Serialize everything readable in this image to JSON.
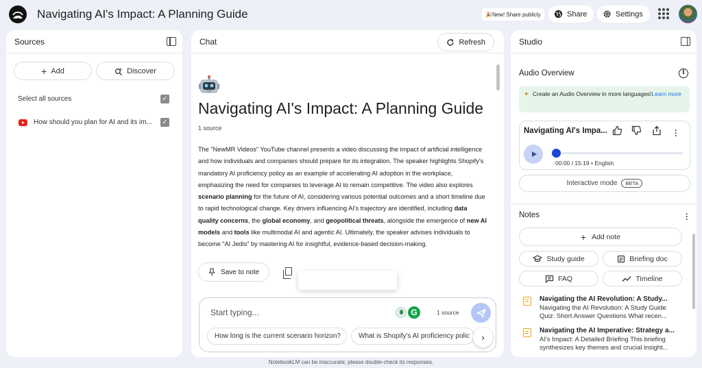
{
  "app": {
    "title": "Navigating AI's Impact: A Planning Guide",
    "new_share": "🎉New! Share publicly",
    "share_label": "Share",
    "settings_label": "Settings",
    "footer": "NotebookLM can be inaccurate; please double-check its responses."
  },
  "sources": {
    "header": "Sources",
    "add_label": "Add",
    "discover_label": "Discover",
    "select_all": "Select all sources",
    "items": [
      {
        "label": "How should you plan for AI and its im...",
        "checked": true
      }
    ]
  },
  "chat": {
    "header": "Chat",
    "refresh_label": "Refresh",
    "title": "Navigating AI's Impact: A Planning Guide",
    "source_count": "1 source",
    "summary_segments": [
      {
        "t": "The \"NewMR Videos\" YouTube channel presents a video discussing the impact of artificial intelligence and how individuals and companies should prepare for its integration. The speaker highlights Shopify's mandatory AI proficiency policy as an example of accelerating AI adoption in the workplace, emphasizing the need for companies to leverage AI to remain competitive. The video also explores ",
        "b": false
      },
      {
        "t": "scenario planning",
        "b": true
      },
      {
        "t": " for the future of AI, considering various potential outcomes and a short timeline due to rapid technological change. Key drivers influencing AI's trajectory are identified, including ",
        "b": false
      },
      {
        "t": "data quality concerns",
        "b": true
      },
      {
        "t": ", the ",
        "b": false
      },
      {
        "t": "global economy",
        "b": true
      },
      {
        "t": ", and ",
        "b": false
      },
      {
        "t": "geopolitical threats",
        "b": true
      },
      {
        "t": ", alongside the emergence of ",
        "b": false
      },
      {
        "t": "new AI models",
        "b": true
      },
      {
        "t": " and ",
        "b": false
      },
      {
        "t": "tools",
        "b": true
      },
      {
        "t": " like multimodal AI and agentic AI. Ultimately, the speaker advises individuals to become \"AI Jedis\" by mastering AI for insightful, evidence-based decision-making.",
        "b": false
      }
    ],
    "save_to_note": "Save to note",
    "composer": {
      "placeholder": "Start typing...",
      "source_count": "1 source",
      "suggestions": [
        "How long is the current scenario horizon?",
        "What is Shopify's AI proficiency polic"
      ]
    }
  },
  "studio": {
    "header": "Studio",
    "audio_overview_title": "Audio Overview",
    "banner_text": "Create an Audio Overview in more languages!",
    "banner_link": "Learn more",
    "audio": {
      "title": "Navigating AI's Impa...",
      "time": "00:00 / 15:19 • English",
      "progress": 0
    },
    "interactive_mode": "Interactive mode",
    "beta": "BETA",
    "notes_title": "Notes",
    "add_note": "Add note",
    "chips": [
      "Study guide",
      "Briefing doc",
      "FAQ",
      "Timeline"
    ],
    "notes": [
      {
        "title": "Navigating the AI Revolution: A Study...",
        "body": "Navigating the AI Revolution: A Study Guide Quiz: Short Answer Questions What recen..."
      },
      {
        "title": "Navigating the AI Imperative: Strategy a...",
        "body": "AI's Impact: A Detailed Briefing This briefing synthesizes key themes and crucial insight..."
      }
    ]
  },
  "colors": {
    "background": "#eef0f8",
    "accent": "#1a47d6",
    "send": "#b3c6f5",
    "youtube": "#e62117",
    "note_icon": "#e3a21a"
  }
}
